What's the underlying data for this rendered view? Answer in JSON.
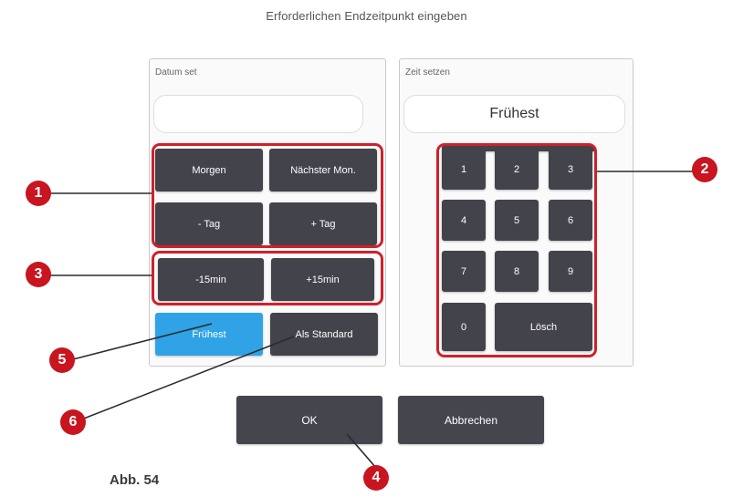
{
  "dialog": {
    "title": "Erforderlichen Endzeitpunkt eingeben",
    "date_panel_label": "Datum set",
    "date_value": "",
    "time_panel_label": "Zeit setzen",
    "time_value": "Frühest"
  },
  "date_buttons": {
    "tomorrow": "Morgen",
    "next_monday": "Nächster Mon.",
    "minus_day": "- Tag",
    "plus_day": "+ Tag",
    "minus_15": "-15min",
    "plus_15": "+15min",
    "earliest": "Frühest",
    "as_default": "Als Standard"
  },
  "keypad": {
    "keys": [
      "1",
      "2",
      "3",
      "4",
      "5",
      "6",
      "7",
      "8",
      "9",
      "0"
    ],
    "clear": "Lösch"
  },
  "footer": {
    "ok": "OK",
    "cancel": "Abbrechen"
  },
  "callouts": [
    "1",
    "2",
    "3",
    "4",
    "5",
    "6"
  ],
  "caption": "Abb. 54",
  "colors": {
    "button": "#43434b",
    "accent_blue": "#2fa3e6",
    "highlight_red": "#d0202a",
    "callout_red": "#c8151f"
  }
}
